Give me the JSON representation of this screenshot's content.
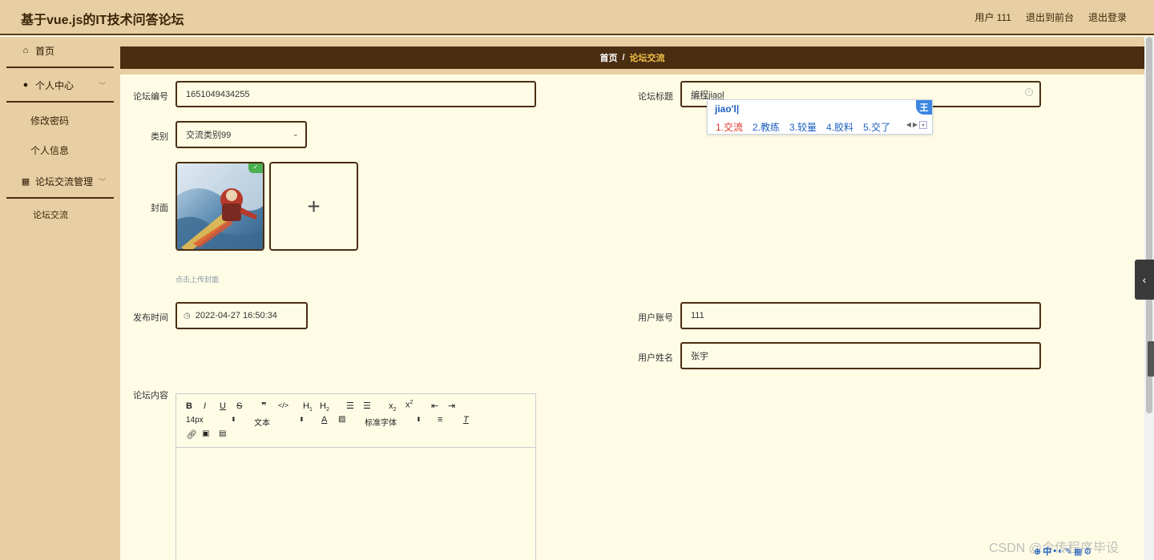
{
  "header": {
    "title": "基于vue.js的IT技术问答论坛",
    "user_label": "用户 111",
    "front_link": "退出到前台",
    "logout_link": "退出登录"
  },
  "sidebar": {
    "items": [
      {
        "label": "首页",
        "icon": "home-icon"
      },
      {
        "label": "个人中心",
        "icon": "user-icon"
      },
      {
        "label": "修改密码"
      },
      {
        "label": "个人信息"
      },
      {
        "label": "论坛交流管理",
        "icon": "grid-icon"
      },
      {
        "label": "论坛交流"
      }
    ]
  },
  "breadcrumb": {
    "home": "首页",
    "separator": "/",
    "current": "论坛交流"
  },
  "form": {
    "forum_id": {
      "label": "论坛编号",
      "value": "1651049434255"
    },
    "forum_title": {
      "label": "论坛标题",
      "value": "编程jiaol"
    },
    "category": {
      "label": "类别",
      "value": "交流类别99"
    },
    "cover": {
      "label": "封面",
      "hint": "点击上传封面",
      "add_symbol": "+"
    },
    "publish_time": {
      "label": "发布时间",
      "value": "2022-04-27 16:50:34"
    },
    "user_account": {
      "label": "用户账号",
      "value": "111"
    },
    "user_name": {
      "label": "用户姓名",
      "value": "张宇"
    },
    "content": {
      "label": "论坛内容"
    }
  },
  "ime": {
    "pinyin": "jiao'l|",
    "candidates": [
      "1.交流",
      "2.教练",
      "3.较量",
      "4.胶料",
      "5.交了"
    ],
    "badge": "王"
  },
  "editor_toolbar": {
    "font_size": "14px",
    "text_type": "文本",
    "font_family": "标准字体"
  },
  "watermark": "CSDN @今传程序毕设"
}
